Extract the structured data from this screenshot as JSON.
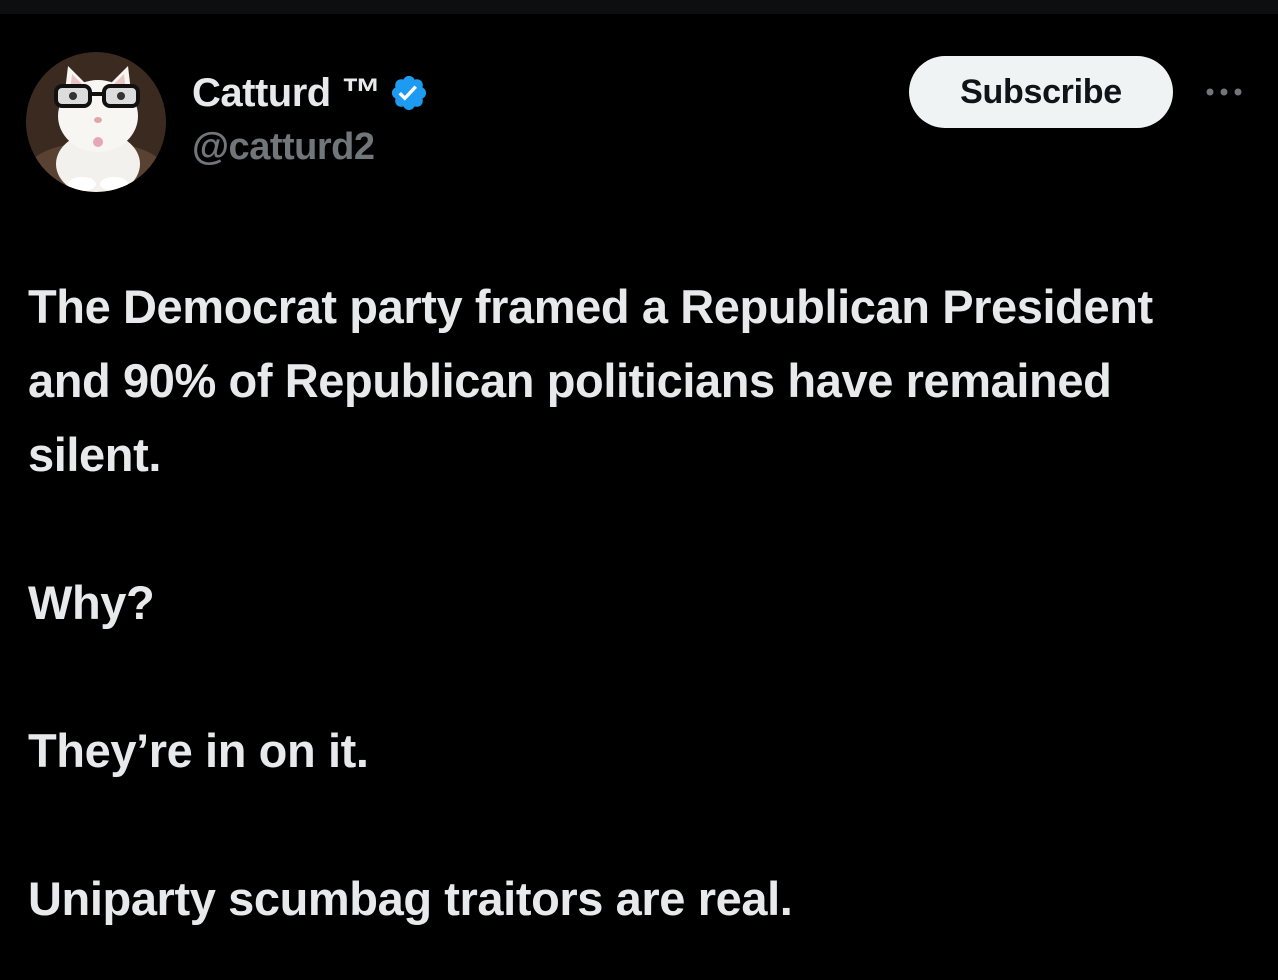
{
  "author": {
    "display_name": "Catturd ™",
    "handle": "@catturd2",
    "verified": true,
    "verified_color": "#1d9bf0",
    "avatar_icon": "cat-with-glasses-avatar"
  },
  "actions": {
    "subscribe_label": "Subscribe",
    "more_icon": "more-horizontal-icon"
  },
  "tweet": {
    "paragraphs": [
      "The Democrat party framed a Republican President and 90% of Republican politicians have remained silent.",
      "Why?",
      "They’re in on it.",
      "Uniparty scumbag traitors are real."
    ]
  },
  "colors": {
    "background": "#000000",
    "text": "#e7e9ea",
    "secondary_text": "#71767b",
    "button_bg": "#eff3f4",
    "button_text": "#0f1419"
  }
}
